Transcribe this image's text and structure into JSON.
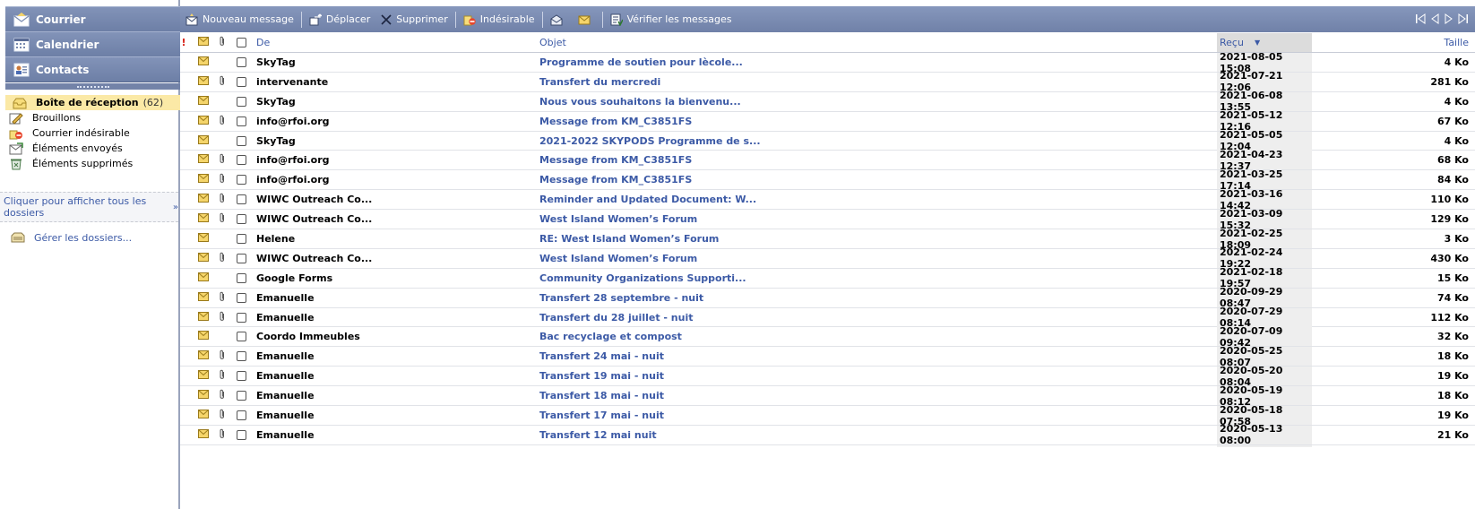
{
  "nav": {
    "mail": "Courrier",
    "calendar": "Calendrier",
    "contacts": "Contacts"
  },
  "folders": [
    {
      "label": "Boîte de réception",
      "count": "(62)",
      "icon": "inbox-icon"
    },
    {
      "label": "Brouillons",
      "count": "",
      "icon": "drafts-icon"
    },
    {
      "label": "Courrier indésirable",
      "count": "",
      "icon": "junk-icon"
    },
    {
      "label": "Éléments envoyés",
      "count": "",
      "icon": "sent-icon"
    },
    {
      "label": "Éléments supprimés",
      "count": "",
      "icon": "deleted-icon"
    }
  ],
  "show_all_folders": "Cliquer pour afficher tous les dossiers",
  "manage_folders": "Gérer les dossiers...",
  "toolbar": {
    "new_message": "Nouveau message",
    "move": "Déplacer",
    "delete": "Supprimer",
    "junk": "Indésirable",
    "check_messages": "Vérifier les messages"
  },
  "columns": {
    "importance": "!",
    "from": "De",
    "subject": "Objet",
    "received": "Reçu",
    "size": "Taille"
  },
  "colors": {
    "accent": "#3c5aa6",
    "toolbar": "#7a8bb1",
    "selected_folder": "#fbe9a6"
  },
  "messages": [
    {
      "from": "SkyTag",
      "subject": "Programme de soutien pour lècole...",
      "received": "2021-08-05 15:08",
      "size": "4 Ko",
      "attachment": false
    },
    {
      "from": "intervenante",
      "subject": "Transfert du mercredi",
      "received": "2021-07-21 12:06",
      "size": "281 Ko",
      "attachment": true
    },
    {
      "from": "SkyTag",
      "subject": "Nous vous souhaitons la bienvenu...",
      "received": "2021-06-08 13:55",
      "size": "4 Ko",
      "attachment": false
    },
    {
      "from": "info@rfoi.org",
      "subject": "Message from KM_C3851FS",
      "received": "2021-05-12 12:16",
      "size": "67 Ko",
      "attachment": true
    },
    {
      "from": "SkyTag",
      "subject": "2021-2022 SKYPODS Programme de s...",
      "received": "2021-05-05 12:04",
      "size": "4 Ko",
      "attachment": false
    },
    {
      "from": "info@rfoi.org",
      "subject": "Message from KM_C3851FS",
      "received": "2021-04-23 12:37",
      "size": "68 Ko",
      "attachment": true
    },
    {
      "from": "info@rfoi.org",
      "subject": "Message from KM_C3851FS",
      "received": "2021-03-25 17:14",
      "size": "84 Ko",
      "attachment": true
    },
    {
      "from": "WIWC Outreach Co...",
      "subject": "Reminder and Updated Document: W...",
      "received": "2021-03-16 14:42",
      "size": "110 Ko",
      "attachment": true
    },
    {
      "from": "WIWC Outreach Co...",
      "subject": "West Island Women’s Forum",
      "received": "2021-03-09 15:32",
      "size": "129 Ko",
      "attachment": true
    },
    {
      "from": "Helene",
      "subject": "RE: West Island Women’s Forum",
      "received": "2021-02-25 18:09",
      "size": "3 Ko",
      "attachment": false
    },
    {
      "from": "WIWC Outreach Co...",
      "subject": "West Island Women’s Forum",
      "received": "2021-02-24 19:22",
      "size": "430 Ko",
      "attachment": true
    },
    {
      "from": "Google Forms",
      "subject": "Community Organizations Supporti...",
      "received": "2021-02-18 19:57",
      "size": "15 Ko",
      "attachment": false
    },
    {
      "from": "Emanuelle",
      "subject": "Transfert 28 septembre - nuit",
      "received": "2020-09-29 08:47",
      "size": "74 Ko",
      "attachment": true
    },
    {
      "from": "Emanuelle",
      "subject": "Transfert du 28 juillet - nuit",
      "received": "2020-07-29 08:14",
      "size": "112 Ko",
      "attachment": true
    },
    {
      "from": "Coordo Immeubles",
      "subject": "Bac recyclage et compost",
      "received": "2020-07-09 09:42",
      "size": "32 Ko",
      "attachment": false
    },
    {
      "from": "Emanuelle",
      "subject": "Transfert 24 mai - nuit",
      "received": "2020-05-25 08:07",
      "size": "18 Ko",
      "attachment": true
    },
    {
      "from": "Emanuelle",
      "subject": "Transfert 19 mai - nuit",
      "received": "2020-05-20 08:04",
      "size": "19 Ko",
      "attachment": true
    },
    {
      "from": "Emanuelle",
      "subject": "Transfert 18 mai - nuit",
      "received": "2020-05-19 08:12",
      "size": "18 Ko",
      "attachment": true
    },
    {
      "from": "Emanuelle",
      "subject": "Transfert 17 mai - nuit",
      "received": "2020-05-18 07:58",
      "size": "19 Ko",
      "attachment": true
    },
    {
      "from": "Emanuelle",
      "subject": "Transfert 12 mai nuit",
      "received": "2020-05-13 08:00",
      "size": "21 Ko",
      "attachment": true
    }
  ]
}
